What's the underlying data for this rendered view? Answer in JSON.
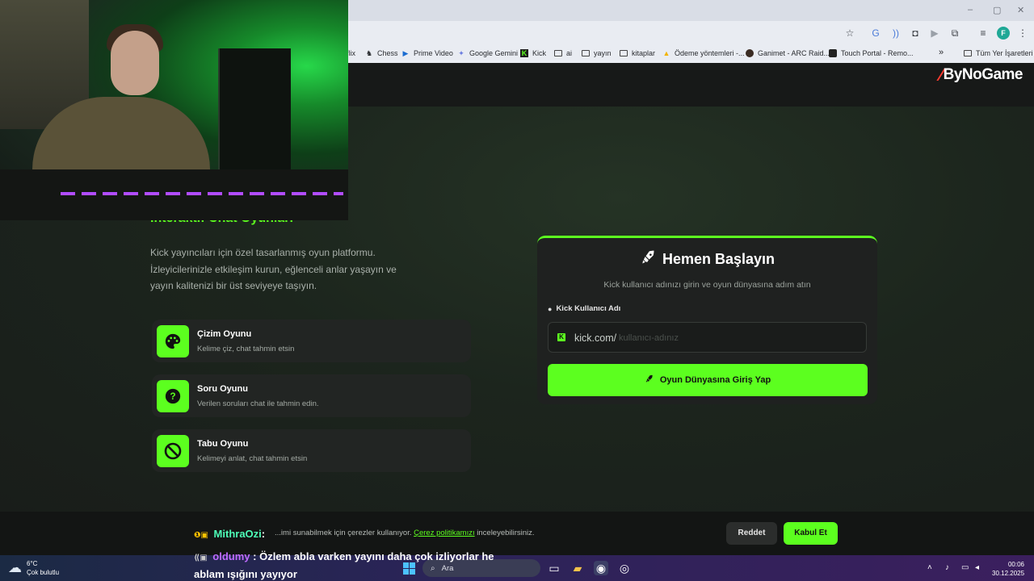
{
  "browser": {
    "window_controls": {
      "minimize": "–",
      "maximize": "▢",
      "close": "✕"
    },
    "bookmarks": [
      {
        "label": "flix",
        "icon": "bookmark-icon"
      },
      {
        "label": "Chess",
        "icon": "chess-icon"
      },
      {
        "label": "Prime Video",
        "icon": "play-icon"
      },
      {
        "label": "Google Gemini",
        "icon": "sparkle-icon"
      },
      {
        "label": "Kick",
        "icon": "kick-icon"
      },
      {
        "label": "ai",
        "icon": "folder-icon"
      },
      {
        "label": "yayın",
        "icon": "folder-icon"
      },
      {
        "label": "kitaplar",
        "icon": "folder-icon"
      },
      {
        "label": "Ödeme yöntemleri -...",
        "icon": "drive-icon"
      },
      {
        "label": "Ganimet - ARC Raid...",
        "icon": "site-icon"
      },
      {
        "label": "Touch Portal - Remo...",
        "icon": "site-icon"
      }
    ],
    "bookmarks_overflow": "»",
    "all_bookmarks": "Tüm Yer İşaretleri",
    "profile_initial": "F"
  },
  "site": {
    "logo": "ByNoGame",
    "hero_title": "İnteraktif Chat Oyunları",
    "hero_desc": [
      "Kick yayıncıları için özel tasarlanmış oyun platformu.",
      "İzleyicilerinizle etkileşim kurun, eğlenceli anlar yaşayın ve",
      "yayın kalitenizi bir üst seviyeye taşıyın."
    ],
    "games": [
      {
        "title": "Çizim Oyunu",
        "subtitle": "Kelime çiz, chat tahmin etsin"
      },
      {
        "title": "Soru Oyunu",
        "subtitle": "Verilen soruları chat ile tahmin edin."
      },
      {
        "title": "Tabu Oyunu",
        "subtitle": "Kelimeyi anlat, chat tahmin etsin"
      }
    ],
    "card": {
      "title": "Hemen Başlayın",
      "subtitle": "Kick kullanıcı adınızı girin ve oyun dünyasına adım atın",
      "field_label": "Kick Kullanıcı Adı",
      "field_prefix": "kick.com/",
      "field_placeholder": "kullanıcı-adınız",
      "button": "Oyun Dünyasına Giriş Yap"
    },
    "cookie": {
      "text_before": "...imi sunabilmek için çerezler kullanıyor.",
      "link": "Çerez politikamızı",
      "text_after": "inceleyebilirsiniz.",
      "reject": "Reddet",
      "accept": "Kabul Et"
    }
  },
  "chat": [
    {
      "user": "MithraOzi",
      "message": ""
    },
    {
      "user": "oldumy",
      "message": "Özlem abla varken yayını daha çok izliyorlar he ablam ışığını yayıyor"
    }
  ],
  "taskbar": {
    "weather_temp": "6°C",
    "weather_desc": "Çok bulutlu",
    "search_placeholder": "Ara",
    "time": "00:06",
    "date": "30.12.2025"
  },
  "colors": {
    "accent": "#5cff1f",
    "logo_red": "#ff3b30",
    "page_bg": "#1b1e1b"
  }
}
